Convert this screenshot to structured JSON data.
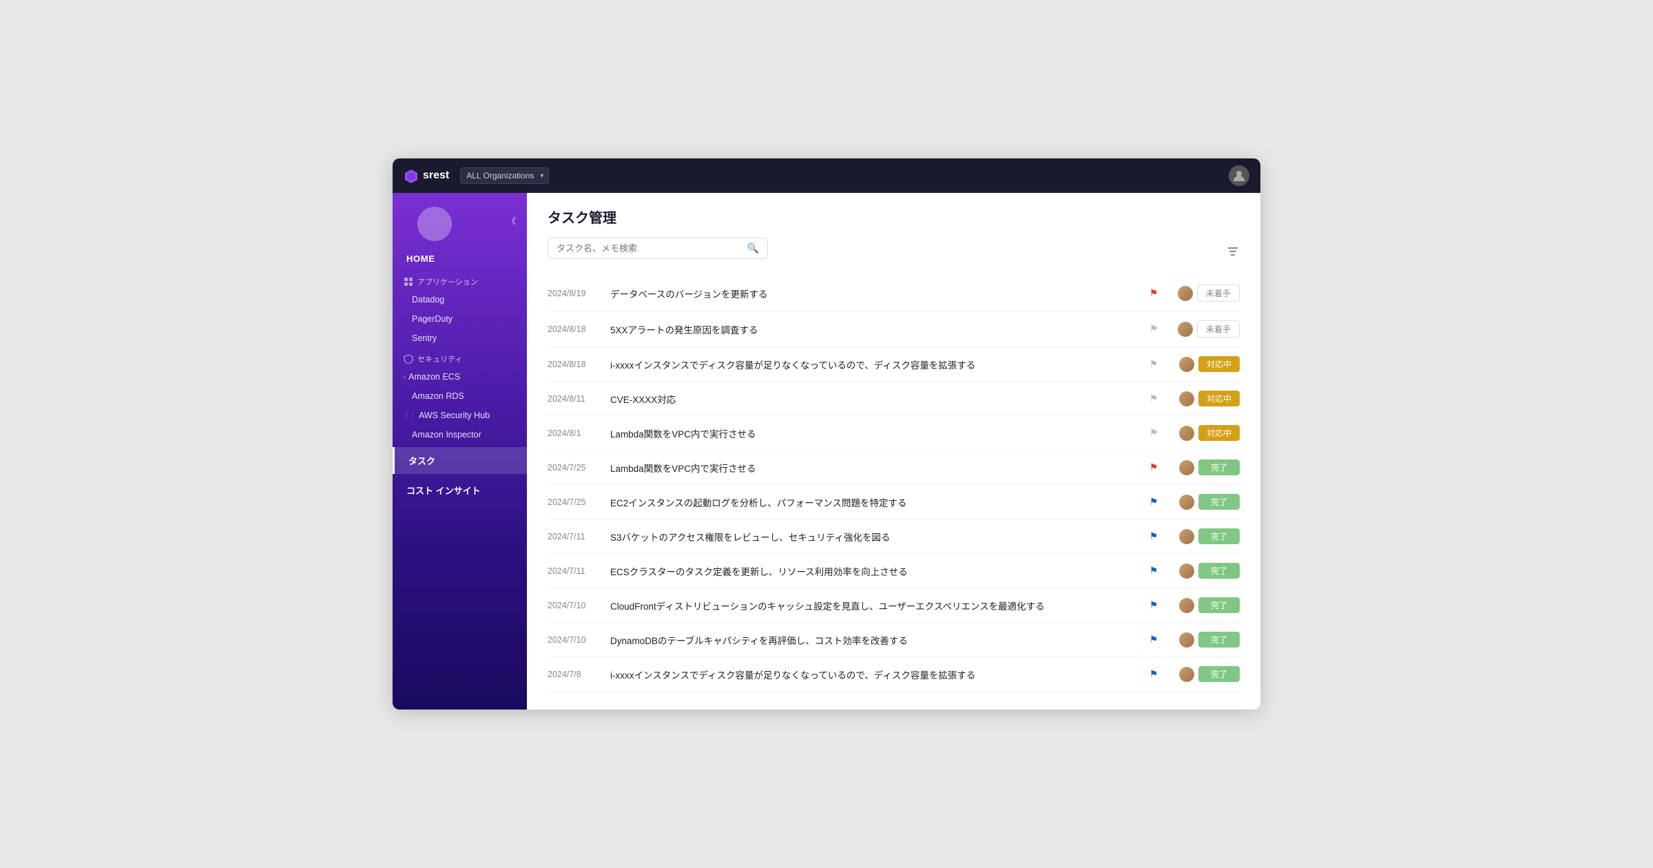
{
  "app": {
    "logo_text": "srest",
    "org_select_value": "ALL Organizations"
  },
  "sidebar": {
    "collapse_btn": "《",
    "home_label": "HOME",
    "app_section_label": "アプリケーション",
    "security_section_label": "セキュリティ",
    "app_items": [
      "Datadog",
      "PagerDuty",
      "Sentry"
    ],
    "security_items": [
      "Amazon ECS",
      "Amazon RDS",
      "AWS Security Hub",
      "Amazon Inspector"
    ],
    "task_label": "タスク",
    "cost_label": "コスト インサイト"
  },
  "content": {
    "page_title": "タスク管理",
    "search_placeholder": "タスク名、メモ検索",
    "tasks": [
      {
        "date": "2024/8/19",
        "text": "データベースのバージョンを更新する",
        "flag": "red",
        "status": "未着手"
      },
      {
        "date": "2024/8/18",
        "text": "5XXアラートの発生原因を調査する",
        "flag": "gray",
        "status": "未着手"
      },
      {
        "date": "2024/8/18",
        "text": "i-xxxxインスタンスでディスク容量が足りなくなっているので、ディスク容量を拡張する",
        "flag": "gray",
        "status": "対応中"
      },
      {
        "date": "2024/8/11",
        "text": "CVE-XXXX対応",
        "flag": "gray",
        "status": "対応中"
      },
      {
        "date": "2024/8/1",
        "text": "Lambda関数をVPC内で実行させる",
        "flag": "gray",
        "status": "対応中"
      },
      {
        "date": "2024/7/25",
        "text": "Lambda関数をVPC内で実行させる",
        "flag": "red",
        "status": "完了"
      },
      {
        "date": "2024/7/25",
        "text": "EC2インスタンスの起動ログを分析し、パフォーマンス問題を特定する",
        "flag": "blue",
        "status": "完了"
      },
      {
        "date": "2024/7/11",
        "text": "S3バケットのアクセス権限をレビューし、セキュリティ強化を図る",
        "flag": "blue",
        "status": "完了"
      },
      {
        "date": "2024/7/11",
        "text": "ECSクラスターのタスク定義を更新し、リソース利用効率を向上させる",
        "flag": "blue",
        "status": "完了"
      },
      {
        "date": "2024/7/10",
        "text": "CloudFrontディストリビューションのキャッシュ設定を見直し、ユーザーエクスペリエンスを最適化する",
        "flag": "blue",
        "status": "完了"
      },
      {
        "date": "2024/7/10",
        "text": "DynamoDBのテーブルキャパシティを再評価し、コスト効率を改善する",
        "flag": "blue",
        "status": "完了"
      },
      {
        "date": "2024/7/8",
        "text": "i-xxxxインスタンスでディスク容量が足りなくなっているので、ディスク容量を拡張する",
        "flag": "blue",
        "status": "完了"
      }
    ]
  }
}
